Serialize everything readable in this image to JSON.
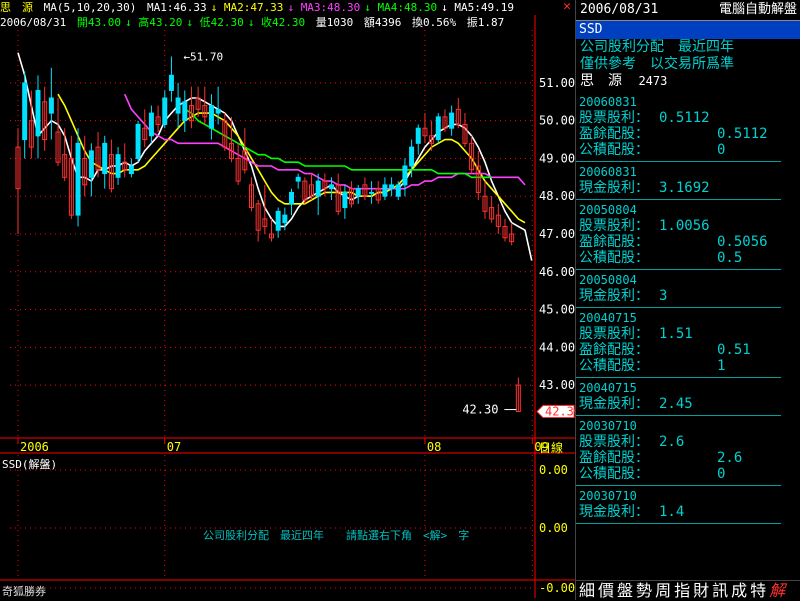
{
  "infobar": {
    "stock": "思　源",
    "ma_params": "MA(5,10,20,30)",
    "ma1": "MA1:46.33",
    "ma2": "MA2:47.33",
    "ma3": "MA3:48.30",
    "ma4": "MA4:48.30",
    "ma5": "MA5:49.19",
    "date": "2006/08/31",
    "open": "開43.00",
    "high": "高43.20",
    "low": "低42.30",
    "close": "收42.30",
    "volume": "量1030",
    "amount": "額4396",
    "turnover": "換0.56%",
    "amplitude": "振1.87"
  },
  "colors": {
    "up": "#00e0ff",
    "down": "#ff3030",
    "ma5": "#ffffff",
    "ma10": "#ffff00",
    "ma20": "#ff40ff",
    "ma30": "#00ff00",
    "grid": "#ff0000",
    "axis": "#ff0000"
  },
  "chart_data": {
    "type": "candlestick",
    "ylim": [
      41.6,
      52.4
    ],
    "yticks": [
      "51.00",
      "50.00",
      "49.00",
      "48.00",
      "47.00",
      "46.00",
      "45.00",
      "44.00",
      "43.00"
    ],
    "ytick_values": [
      51,
      50,
      49,
      48,
      47,
      46,
      45,
      44,
      43
    ],
    "xticks": [
      "2006",
      "07",
      "08",
      "09"
    ],
    "xtick_positions": [
      0,
      22,
      61,
      104
    ],
    "xlabel": "日線",
    "high_marker": "51.70",
    "low_marker": "42.30",
    "last_price": "42.30",
    "candles": [
      {
        "o": 49.3,
        "h": 49.8,
        "l": 47.0,
        "c": 48.2
      },
      {
        "o": 49.5,
        "h": 51.3,
        "l": 49.0,
        "c": 51.0
      },
      {
        "o": 50.0,
        "h": 50.8,
        "l": 49.0,
        "c": 49.3
      },
      {
        "o": 49.6,
        "h": 51.2,
        "l": 49.0,
        "c": 50.8
      },
      {
        "o": 50.5,
        "h": 50.9,
        "l": 49.2,
        "c": 49.5
      },
      {
        "o": 50.2,
        "h": 51.4,
        "l": 49.5,
        "c": 50.6
      },
      {
        "o": 49.7,
        "h": 50.6,
        "l": 48.8,
        "c": 48.9
      },
      {
        "o": 49.1,
        "h": 49.8,
        "l": 48.4,
        "c": 48.5
      },
      {
        "o": 49.0,
        "h": 49.6,
        "l": 47.4,
        "c": 47.5
      },
      {
        "o": 47.5,
        "h": 49.8,
        "l": 47.2,
        "c": 49.4
      },
      {
        "o": 49.0,
        "h": 49.6,
        "l": 48.0,
        "c": 48.3
      },
      {
        "o": 48.5,
        "h": 49.4,
        "l": 48.0,
        "c": 49.2
      },
      {
        "o": 49.3,
        "h": 49.7,
        "l": 48.5,
        "c": 48.7
      },
      {
        "o": 48.6,
        "h": 49.6,
        "l": 48.2,
        "c": 49.4
      },
      {
        "o": 49.1,
        "h": 49.5,
        "l": 48.1,
        "c": 48.2
      },
      {
        "o": 48.5,
        "h": 49.3,
        "l": 48.3,
        "c": 49.1
      },
      {
        "o": 48.9,
        "h": 49.4,
        "l": 48.5,
        "c": 48.7
      },
      {
        "o": 48.6,
        "h": 49.0,
        "l": 48.5,
        "c": 48.8
      },
      {
        "o": 49.0,
        "h": 50.0,
        "l": 48.9,
        "c": 49.9
      },
      {
        "o": 49.8,
        "h": 50.3,
        "l": 49.3,
        "c": 49.5
      },
      {
        "o": 49.6,
        "h": 50.4,
        "l": 49.4,
        "c": 50.2
      },
      {
        "o": 50.1,
        "h": 50.4,
        "l": 49.7,
        "c": 49.9
      },
      {
        "o": 49.9,
        "h": 50.8,
        "l": 49.8,
        "c": 50.6
      },
      {
        "o": 50.8,
        "h": 51.7,
        "l": 50.5,
        "c": 51.2
      },
      {
        "o": 50.2,
        "h": 51.0,
        "l": 49.8,
        "c": 50.6
      },
      {
        "o": 50.0,
        "h": 50.8,
        "l": 49.7,
        "c": 50.5
      },
      {
        "o": 50.4,
        "h": 50.9,
        "l": 49.8,
        "c": 50.0
      },
      {
        "o": 50.6,
        "h": 50.9,
        "l": 50.1,
        "c": 50.3
      },
      {
        "o": 50.4,
        "h": 50.9,
        "l": 49.9,
        "c": 50.1
      },
      {
        "o": 49.8,
        "h": 50.7,
        "l": 49.5,
        "c": 50.4
      },
      {
        "o": 50.2,
        "h": 50.9,
        "l": 49.9,
        "c": 50.3
      },
      {
        "o": 50.0,
        "h": 50.2,
        "l": 49.2,
        "c": 49.3
      },
      {
        "o": 49.4,
        "h": 50.1,
        "l": 48.9,
        "c": 49.0
      },
      {
        "o": 49.0,
        "h": 49.4,
        "l": 48.3,
        "c": 48.4
      },
      {
        "o": 49.2,
        "h": 49.8,
        "l": 48.6,
        "c": 48.7
      },
      {
        "o": 48.3,
        "h": 48.5,
        "l": 47.6,
        "c": 47.7
      },
      {
        "o": 47.8,
        "h": 47.9,
        "l": 46.8,
        "c": 47.1
      },
      {
        "o": 47.4,
        "h": 48.3,
        "l": 47.0,
        "c": 47.2
      },
      {
        "o": 47.0,
        "h": 47.4,
        "l": 46.8,
        "c": 46.9
      },
      {
        "o": 47.1,
        "h": 47.7,
        "l": 46.9,
        "c": 47.6
      },
      {
        "o": 47.3,
        "h": 47.7,
        "l": 47.1,
        "c": 47.5
      },
      {
        "o": 47.8,
        "h": 48.2,
        "l": 47.5,
        "c": 48.1
      },
      {
        "o": 48.4,
        "h": 48.6,
        "l": 48.2,
        "c": 48.5
      },
      {
        "o": 48.4,
        "h": 48.5,
        "l": 47.8,
        "c": 47.9
      },
      {
        "o": 48.3,
        "h": 48.6,
        "l": 47.9,
        "c": 48.0
      },
      {
        "o": 48.0,
        "h": 48.6,
        "l": 47.5,
        "c": 48.4
      },
      {
        "o": 48.4,
        "h": 48.6,
        "l": 48.0,
        "c": 48.2
      },
      {
        "o": 48.2,
        "h": 48.5,
        "l": 47.9,
        "c": 48.3
      },
      {
        "o": 48.3,
        "h": 48.6,
        "l": 47.5,
        "c": 47.6
      },
      {
        "o": 47.7,
        "h": 48.3,
        "l": 47.4,
        "c": 48.1
      },
      {
        "o": 48.2,
        "h": 48.4,
        "l": 47.7,
        "c": 47.8
      },
      {
        "o": 48.0,
        "h": 48.3,
        "l": 47.8,
        "c": 48.2
      },
      {
        "o": 48.3,
        "h": 48.5,
        "l": 47.9,
        "c": 48.0
      },
      {
        "o": 48.1,
        "h": 48.4,
        "l": 47.8,
        "c": 48.1
      },
      {
        "o": 48.2,
        "h": 48.4,
        "l": 47.8,
        "c": 47.9
      },
      {
        "o": 48.0,
        "h": 48.5,
        "l": 47.9,
        "c": 48.3
      },
      {
        "o": 48.2,
        "h": 48.5,
        "l": 48.0,
        "c": 48.3
      },
      {
        "o": 48.0,
        "h": 48.4,
        "l": 47.9,
        "c": 48.3
      },
      {
        "o": 48.3,
        "h": 49.0,
        "l": 48.0,
        "c": 48.8
      },
      {
        "o": 48.8,
        "h": 49.5,
        "l": 48.5,
        "c": 49.3
      },
      {
        "o": 49.4,
        "h": 49.9,
        "l": 49.1,
        "c": 49.8
      },
      {
        "o": 49.8,
        "h": 50.2,
        "l": 49.4,
        "c": 49.6
      },
      {
        "o": 49.6,
        "h": 50.0,
        "l": 49.2,
        "c": 49.4
      },
      {
        "o": 49.5,
        "h": 50.2,
        "l": 49.4,
        "c": 50.1
      },
      {
        "o": 50.1,
        "h": 50.3,
        "l": 49.7,
        "c": 49.8
      },
      {
        "o": 49.8,
        "h": 50.4,
        "l": 49.6,
        "c": 50.2
      },
      {
        "o": 50.3,
        "h": 50.6,
        "l": 49.8,
        "c": 49.9
      },
      {
        "o": 49.9,
        "h": 50.2,
        "l": 49.3,
        "c": 49.4
      },
      {
        "o": 49.4,
        "h": 49.6,
        "l": 48.6,
        "c": 48.7
      },
      {
        "o": 48.8,
        "h": 49.2,
        "l": 47.9,
        "c": 48.1
      },
      {
        "o": 48.0,
        "h": 48.4,
        "l": 47.4,
        "c": 47.6
      },
      {
        "o": 47.7,
        "h": 48.0,
        "l": 47.3,
        "c": 47.4
      },
      {
        "o": 47.5,
        "h": 47.8,
        "l": 47.0,
        "c": 47.2
      },
      {
        "o": 47.2,
        "h": 47.4,
        "l": 46.8,
        "c": 46.9
      },
      {
        "o": 47.0,
        "h": 47.3,
        "l": 46.7,
        "c": 46.8
      },
      {
        "o": 43.0,
        "h": 43.2,
        "l": 42.3,
        "c": 42.3
      }
    ],
    "ma_series": [
      {
        "name": "MA5",
        "color": "#ffffff",
        "values": [
          51.8,
          51.2,
          50.4,
          49.6,
          49.8,
          50.0,
          49.9,
          49.6,
          49.0,
          48.5,
          48.5,
          48.4,
          48.7,
          48.7,
          48.8,
          48.8,
          48.9,
          48.8,
          48.9,
          49.2,
          49.4,
          49.6,
          50.0,
          50.2,
          50.4,
          50.5,
          50.6,
          50.6,
          50.5,
          50.4,
          50.3,
          50.2,
          50.0,
          49.6,
          49.2,
          48.8,
          48.2,
          47.7,
          47.4,
          47.2,
          47.2,
          47.4,
          47.7,
          47.9,
          48.0,
          48.1,
          48.2,
          48.3,
          48.1,
          48.0,
          47.9,
          48.0,
          48.0,
          48.0,
          48.1,
          48.1,
          48.2,
          48.2,
          48.4,
          48.7,
          49.0,
          49.3,
          49.5,
          49.7,
          49.8,
          49.9,
          49.9,
          49.8,
          49.6,
          49.3,
          48.9,
          48.4,
          48.0,
          47.6,
          47.3,
          47.2,
          47.1,
          46.3
        ]
      },
      {
        "name": "MA10",
        "color": "#ffff00",
        "values": [
          null,
          null,
          null,
          null,
          null,
          null,
          50.7,
          50.4,
          50.0,
          49.6,
          49.2,
          48.9,
          48.8,
          48.7,
          48.6,
          48.6,
          48.7,
          48.7,
          48.7,
          48.8,
          49.0,
          49.2,
          49.4,
          49.6,
          49.8,
          50.0,
          50.1,
          50.2,
          50.2,
          50.2,
          50.1,
          50.0,
          49.8,
          49.6,
          49.3,
          49.0,
          48.7,
          48.4,
          48.1,
          47.9,
          47.8,
          47.8,
          47.8,
          47.8,
          47.9,
          48.0,
          48.1,
          48.1,
          48.1,
          48.1,
          48.1,
          48.0,
          48.0,
          48.0,
          48.1,
          48.1,
          48.2,
          48.3,
          48.5,
          48.7,
          48.9,
          49.1,
          49.3,
          49.4,
          49.5,
          49.5,
          49.4,
          49.2,
          49.0,
          48.7,
          48.4,
          48.2,
          48.0,
          47.8,
          47.6,
          47.4,
          47.3
        ]
      },
      {
        "name": "MA20",
        "color": "#ff40ff",
        "values": [
          null,
          null,
          null,
          null,
          null,
          null,
          null,
          null,
          null,
          null,
          null,
          null,
          null,
          null,
          null,
          null,
          50.7,
          50.3,
          50.1,
          49.9,
          49.7,
          49.6,
          49.5,
          49.5,
          49.4,
          49.4,
          49.4,
          49.4,
          49.4,
          49.4,
          49.4,
          49.3,
          49.2,
          49.1,
          49.0,
          48.9,
          48.8,
          48.8,
          48.8,
          48.7,
          48.7,
          48.7,
          48.7,
          48.6,
          48.6,
          48.5,
          48.4,
          48.4,
          48.3,
          48.3,
          48.2,
          48.2,
          48.2,
          48.2,
          48.2,
          48.2,
          48.2,
          48.2,
          48.2,
          48.3,
          48.3,
          48.4,
          48.4,
          48.5,
          48.5,
          48.5,
          48.6,
          48.6,
          48.6,
          48.6,
          48.6,
          48.5,
          48.5,
          48.5,
          48.5,
          48.5,
          48.3
        ]
      },
      {
        "name": "MA30",
        "color": "#00ff00",
        "values": [
          null,
          null,
          null,
          null,
          null,
          null,
          null,
          null,
          null,
          null,
          null,
          null,
          null,
          null,
          null,
          null,
          null,
          null,
          null,
          null,
          null,
          null,
          null,
          null,
          null,
          50.3,
          50.2,
          50.0,
          49.9,
          49.8,
          49.7,
          49.6,
          49.5,
          49.4,
          49.3,
          49.2,
          49.1,
          49.1,
          49.0,
          49.0,
          48.9,
          48.9,
          48.9,
          48.8,
          48.8,
          48.8,
          48.8,
          48.8,
          48.8,
          48.8,
          48.7,
          48.7,
          48.7,
          48.7,
          48.7,
          48.7,
          48.7,
          48.7,
          48.7,
          48.7,
          48.7,
          48.7,
          48.7,
          48.6,
          48.6,
          48.6,
          48.6,
          48.6,
          48.5,
          48.5,
          48.5,
          48.5
        ]
      }
    ]
  },
  "sub_chart": {
    "label": "SSD(解盤)",
    "yticks": [
      "0.00",
      "0.00",
      "-0.00"
    ],
    "message": "公司股利分配　最近四年　　請點選右下角　<解>　字"
  },
  "bottom_left_label": "奇狐勝券",
  "side_panel": {
    "date": "2006/08/31",
    "title": "電腦自動解盤",
    "ssd": "SSD",
    "line1": "公司股利分配　最近四年",
    "line2": "僅供參考　以交易所爲準",
    "stock_name": "思　源",
    "stock_code": "2473",
    "records": [
      {
        "date": "20060831",
        "stock_div": "0.5112",
        "earn_div": "0.5112",
        "reserve_div": "0"
      },
      {
        "date": "20060831",
        "cash_div": "3.1692"
      },
      {
        "date": "20050804",
        "stock_div": "1.0056",
        "earn_div": "0.5056",
        "reserve_div": "0.5"
      },
      {
        "date": "20050804",
        "cash_div": "3"
      },
      {
        "date": "20040715",
        "stock_div": "1.51",
        "earn_div": "0.51",
        "reserve_div": "1"
      },
      {
        "date": "20040715",
        "cash_div": "2.45"
      },
      {
        "date": "20030710",
        "stock_div": "2.6",
        "earn_div": "2.6",
        "reserve_div": "0"
      },
      {
        "date": "20030710",
        "cash_div": "1.4"
      }
    ],
    "labels": {
      "stock_div": "股票股利：",
      "earn_div": "盈餘配股：",
      "reserve_div": "公積配股：",
      "cash_div": "現金股利："
    },
    "nav": [
      "細",
      "價",
      "盤",
      "勢",
      "周",
      "指",
      "財",
      "訊",
      "成",
      "特",
      "解"
    ]
  }
}
